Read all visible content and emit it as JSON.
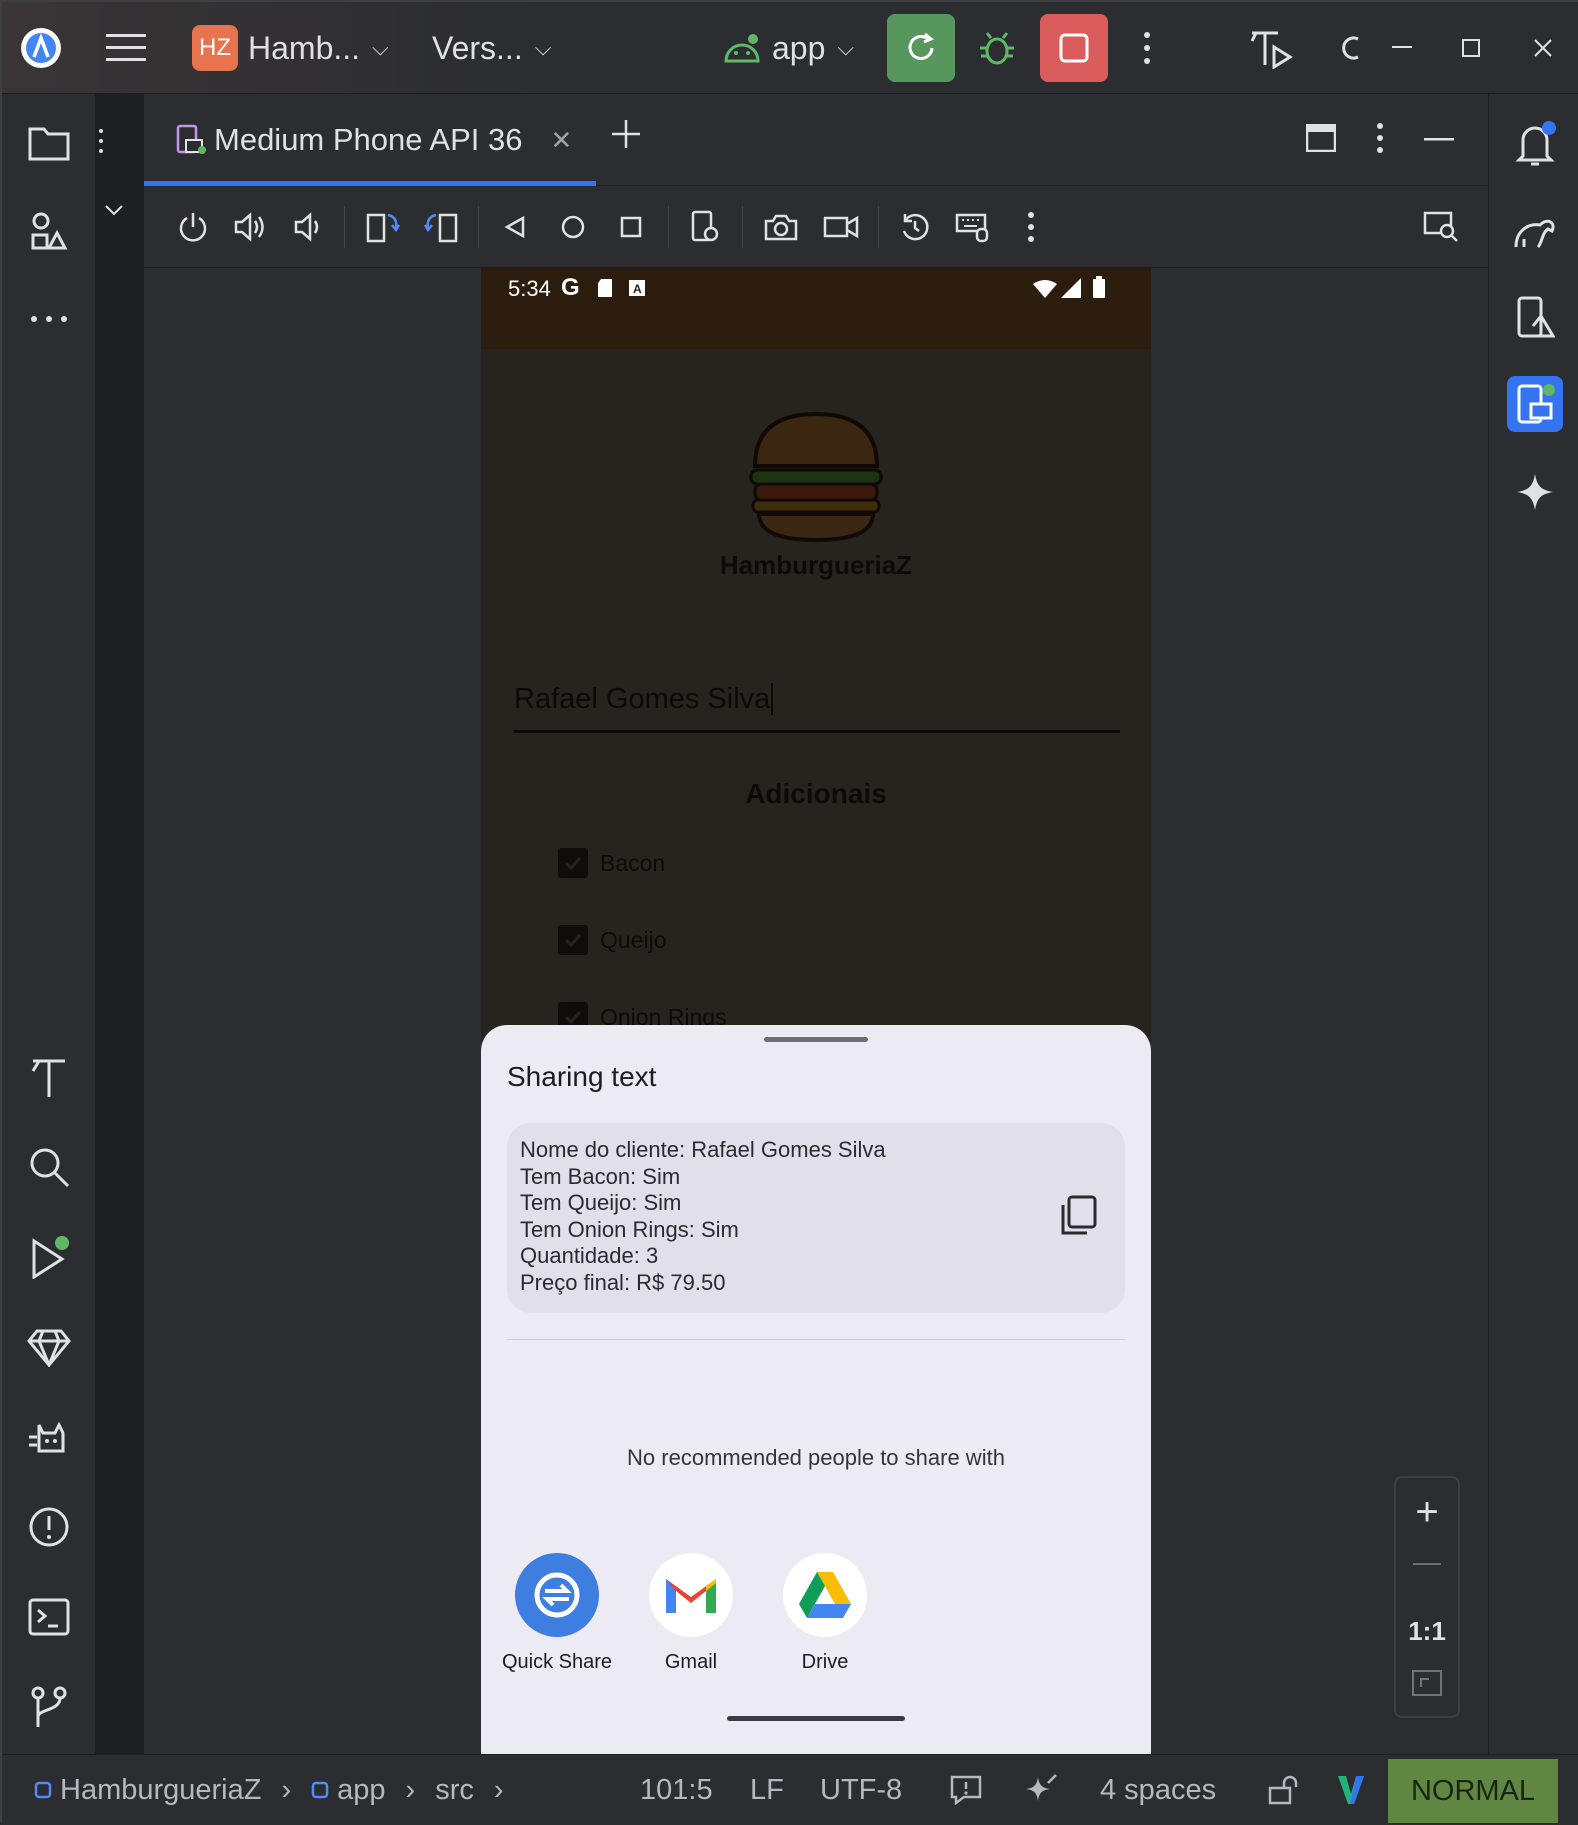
{
  "titlebar": {
    "project_badge": "HZ",
    "project_name": "Hamb...",
    "vcs_label": "Vers...",
    "run_config": "app"
  },
  "tabs": [
    {
      "label": "Medium Phone API 36"
    }
  ],
  "phone": {
    "status_time": "5:34",
    "app_title": "HamburgueriaZ",
    "name_value": "Rafael Gomes Silva",
    "section_title": "Adicionais",
    "checkboxes": [
      {
        "label": "Bacon",
        "checked": true
      },
      {
        "label": "Queijo",
        "checked": true
      },
      {
        "label": "Onion Rings",
        "checked": true
      }
    ],
    "share_sheet": {
      "title": "Sharing text",
      "preview_lines": [
        "Nome do cliente: Rafael Gomes Silva",
        "Tem Bacon: Sim",
        "Tem Queijo: Sim",
        "Tem Onion Rings: Sim",
        "Quantidade: 3",
        "Preço final: R$ 79.50"
      ],
      "no_people": "No recommended people to share with",
      "targets": [
        {
          "label": "Quick Share",
          "icon": "quick-share-icon"
        },
        {
          "label": "Gmail",
          "icon": "gmail-icon"
        },
        {
          "label": "Drive",
          "icon": "drive-icon"
        }
      ]
    }
  },
  "zoom": {
    "plus": "+",
    "minus": "—",
    "one_to_one": "1:1"
  },
  "statusline": {
    "breadcrumb": [
      "HamburgueriaZ",
      "app",
      "src"
    ],
    "position": "101:5",
    "line_ending": "LF",
    "encoding": "UTF-8",
    "indent": "4 spaces",
    "vim_mode": "NORMAL"
  },
  "colors": {
    "accent": "#3574f0",
    "run_green": "#57965c",
    "stop_red": "#db5c5c",
    "vim_green": "#5f8741"
  }
}
